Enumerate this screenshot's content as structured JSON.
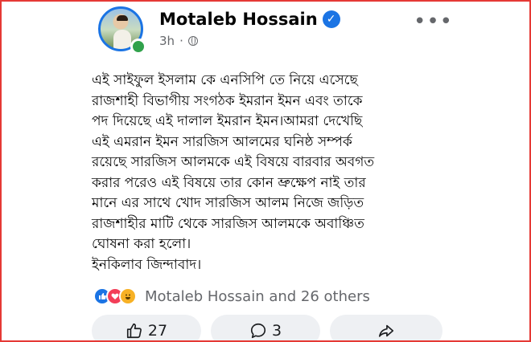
{
  "post": {
    "author": "Motaleb Hossain",
    "time": "3h",
    "separator": "·",
    "more_icon": "•••",
    "verified_icon": "✓",
    "text": "এই সাইফুল ইসলাম কে এনসিপি তে নিয়ে এসেছে\nরাজশাহী বিভাগীয় সংগঠক ইমরান ইমন এবং তাকে\nপদ দিয়েছে এই দালাল ইমরান ইমন।আমরা দেখেছি\nএই এমরান ইমন সারজিস আলমের ঘনিষ্ঠ সম্পর্ক\nরয়েছে সারজিস আলমকে এই বিষয়ে বারবার অবগত\nকরার পরেও এই বিষয়ে তার কোন ভ্রুক্ষেপ নাই তার\nমানে এর সাথে খোদ সারজিস আলম নিজে জড়িত\nরাজশাহীর মাটি থেকে সারজিস আলমকে অবাঞ্চিত\nঘোষনা করা হলো।\nইনকিলাব জিন্দাবাদ।",
    "reactions_text": "Motaleb Hossain and 26 others",
    "reaction_types": [
      "like",
      "love",
      "haha"
    ]
  },
  "actions": {
    "like_count": "27",
    "comment_count": "3"
  },
  "colors": {
    "accent": "#1b74e4",
    "online": "#31a24c",
    "frame_border": "#e53935"
  }
}
